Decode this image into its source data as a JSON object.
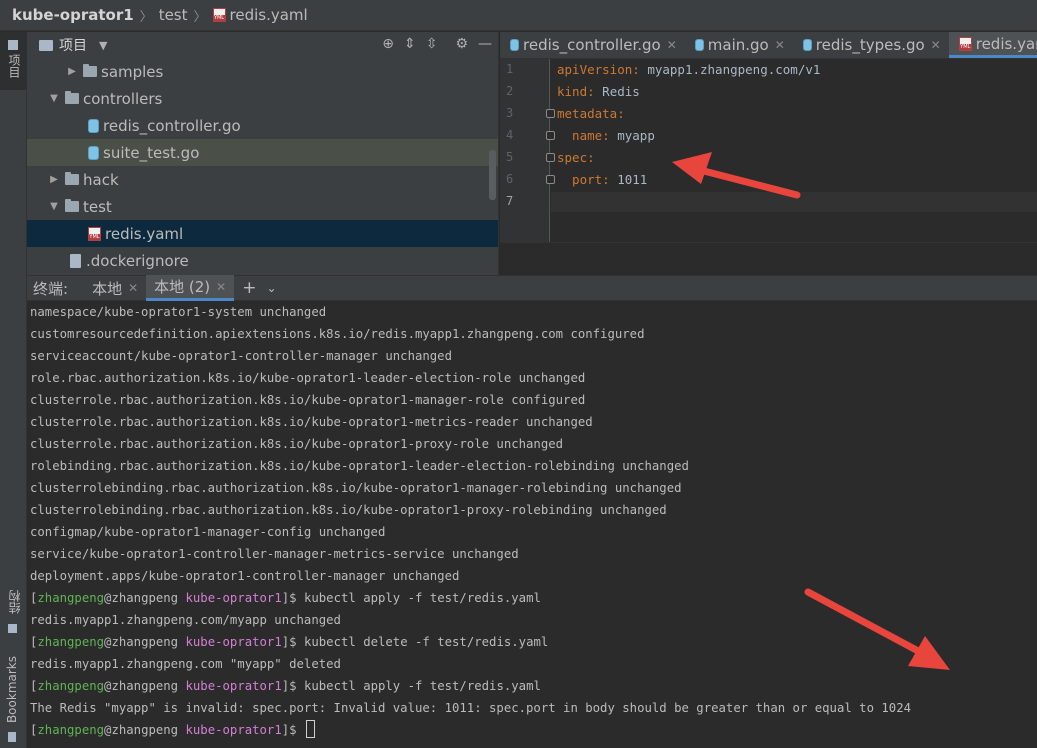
{
  "breadcrumb": {
    "project": "kube-oprator1",
    "folder": "test",
    "file": "redis.yaml"
  },
  "left_strip": {
    "project_tab": "项目",
    "structure_tab": "结构",
    "bookmarks_tab": "Bookmarks"
  },
  "project_panel": {
    "title": "项目",
    "tree": [
      {
        "label": "samples",
        "kind": "folder",
        "expanded": false
      },
      {
        "label": "controllers",
        "kind": "folder",
        "expanded": true
      },
      {
        "label": "redis_controller.go",
        "kind": "go"
      },
      {
        "label": "suite_test.go",
        "kind": "go",
        "highlighted": true
      },
      {
        "label": "hack",
        "kind": "folder",
        "expanded": false
      },
      {
        "label": "test",
        "kind": "folder",
        "expanded": true
      },
      {
        "label": "redis.yaml",
        "kind": "yaml",
        "selected": true
      },
      {
        "label": ".dockerignore",
        "kind": "file"
      }
    ]
  },
  "editor_tabs": [
    {
      "label": "redis_controller.go",
      "icon": "go-file-icon"
    },
    {
      "label": "main.go",
      "icon": "go-file-icon"
    },
    {
      "label": "redis_types.go",
      "icon": "go-file-icon"
    },
    {
      "label": "redis.yaml",
      "icon": "yaml-file-icon",
      "active": true
    }
  ],
  "editor": {
    "line_numbers": [
      "1",
      "2",
      "3",
      "4",
      "5",
      "6",
      "7"
    ],
    "lines": [
      {
        "key": "apiVersion",
        "value": " myapp1.zhangpeng.com/v1"
      },
      {
        "key": "kind",
        "value": " Redis"
      },
      {
        "key": "metadata",
        "value": ""
      },
      {
        "key": "  name",
        "value": " myapp"
      },
      {
        "key": "spec",
        "value": ""
      },
      {
        "key": "  port",
        "value": " 1011"
      },
      {
        "key": "",
        "value": ""
      }
    ]
  },
  "terminal_tabs": {
    "label": "终端:",
    "tabs": [
      {
        "label": "本地",
        "active": false
      },
      {
        "label": "本地 (2)",
        "active": true
      }
    ],
    "add": "+",
    "dropdown": "⌄"
  },
  "terminal": {
    "output_lines": [
      "namespace/kube-oprator1-system unchanged",
      "customresourcedefinition.apiextensions.k8s.io/redis.myapp1.zhangpeng.com configured",
      "serviceaccount/kube-oprator1-controller-manager unchanged",
      "role.rbac.authorization.k8s.io/kube-oprator1-leader-election-role unchanged",
      "clusterrole.rbac.authorization.k8s.io/kube-oprator1-manager-role configured",
      "clusterrole.rbac.authorization.k8s.io/kube-oprator1-metrics-reader unchanged",
      "clusterrole.rbac.authorization.k8s.io/kube-oprator1-proxy-role unchanged",
      "rolebinding.rbac.authorization.k8s.io/kube-oprator1-leader-election-rolebinding unchanged",
      "clusterrolebinding.rbac.authorization.k8s.io/kube-oprator1-manager-rolebinding unchanged",
      "clusterrolebinding.rbac.authorization.k8s.io/kube-oprator1-proxy-rolebinding unchanged",
      "configmap/kube-oprator1-manager-config unchanged",
      "service/kube-oprator1-controller-manager-metrics-service unchanged",
      "deployment.apps/kube-oprator1-controller-manager unchanged"
    ],
    "prompt": {
      "user": "zhangpeng",
      "at": "@",
      "host": "zhangpeng",
      "dir": "kube-oprator1"
    },
    "session": [
      {
        "command": "$ kubectl apply -f test/redis.yaml",
        "output": "redis.myapp1.zhangpeng.com/myapp unchanged"
      },
      {
        "command": "$ kubectl delete -f test/redis.yaml",
        "output": "redis.myapp1.zhangpeng.com \"myapp\" deleted"
      },
      {
        "command": "$ kubectl apply -f test/redis.yaml",
        "output": "The Redis \"myapp\" is invalid: spec.port: Invalid value: 1011: spec.port in body should be greater than or equal to 1024"
      }
    ],
    "final_prompt_suffix": "$ "
  },
  "colors": {
    "accent": "#4a88c7",
    "arrow": "#e8453c",
    "yaml_key": "#cc7832",
    "prompt_user": "#5fb454",
    "prompt_dir": "#d27fd3"
  }
}
